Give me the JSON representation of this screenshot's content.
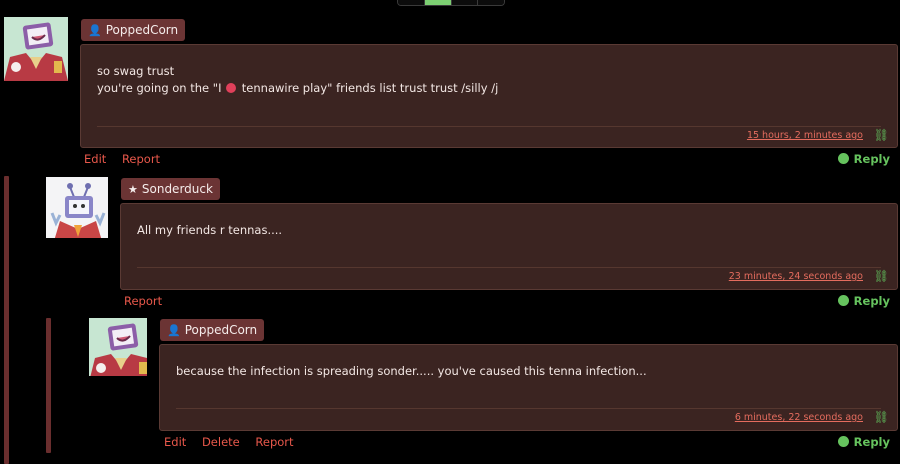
{
  "icons": {
    "user": "user-icon",
    "star": "star-icon",
    "link": "link-icon",
    "reply": "reply-bubble-icon"
  },
  "colors": {
    "accent_red": "#e8584b",
    "reply_green": "#66c35e",
    "post_bg": "#3b2421",
    "tag_bg": "#6b3434",
    "thread_line": "#6a2e2e"
  },
  "posts": [
    {
      "author": "PoppedCorn",
      "line1": "so swag trust",
      "line2_before": "you're going on the \"I",
      "line2_after": "tennawire play\" friends list trust trust /silly /j",
      "timestamp": "15 hours, 2 minutes ago",
      "actions": [
        "Edit",
        "Report"
      ],
      "reply": "Reply"
    },
    {
      "author": "Sonderduck",
      "line1": "All my friends r tennas....",
      "timestamp": "23 minutes, 24 seconds ago",
      "actions": [
        "Report"
      ],
      "reply": "Reply"
    },
    {
      "author": "PoppedCorn",
      "line1": "because the infection is spreading sonder..... you've caused this tenna infection...",
      "timestamp": "6 minutes, 22 seconds ago",
      "actions": [
        "Edit",
        "Delete",
        "Report"
      ],
      "reply": "Reply"
    }
  ]
}
